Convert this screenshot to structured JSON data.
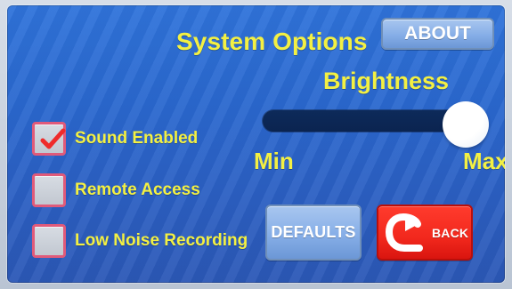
{
  "app": {
    "title": "System Options"
  },
  "buttons": {
    "about_label": "ABOUT",
    "defaults_label": "DEFAULTS",
    "back_label": "BACK"
  },
  "brightness": {
    "label": "Brightness",
    "min_label": "Min",
    "max_label": "Max",
    "value_percent": 95
  },
  "options": [
    {
      "label": "Sound Enabled",
      "checked": true
    },
    {
      "label": "Remote Access",
      "checked": false
    },
    {
      "label": "Low Noise Recording",
      "checked": false
    }
  ],
  "icons": {
    "back": "back-arrow-icon",
    "check": "checkmark-icon"
  },
  "colors": {
    "screen_blue": "#2f73da",
    "text_yellow": "#f3f043",
    "button_blue": "#86aee7",
    "back_red": "#f2281d",
    "checkbox_border": "#e05a7a",
    "check_red": "#ef2b2b",
    "slider_track": "#0f2f63",
    "slider_thumb": "#ffffff"
  }
}
